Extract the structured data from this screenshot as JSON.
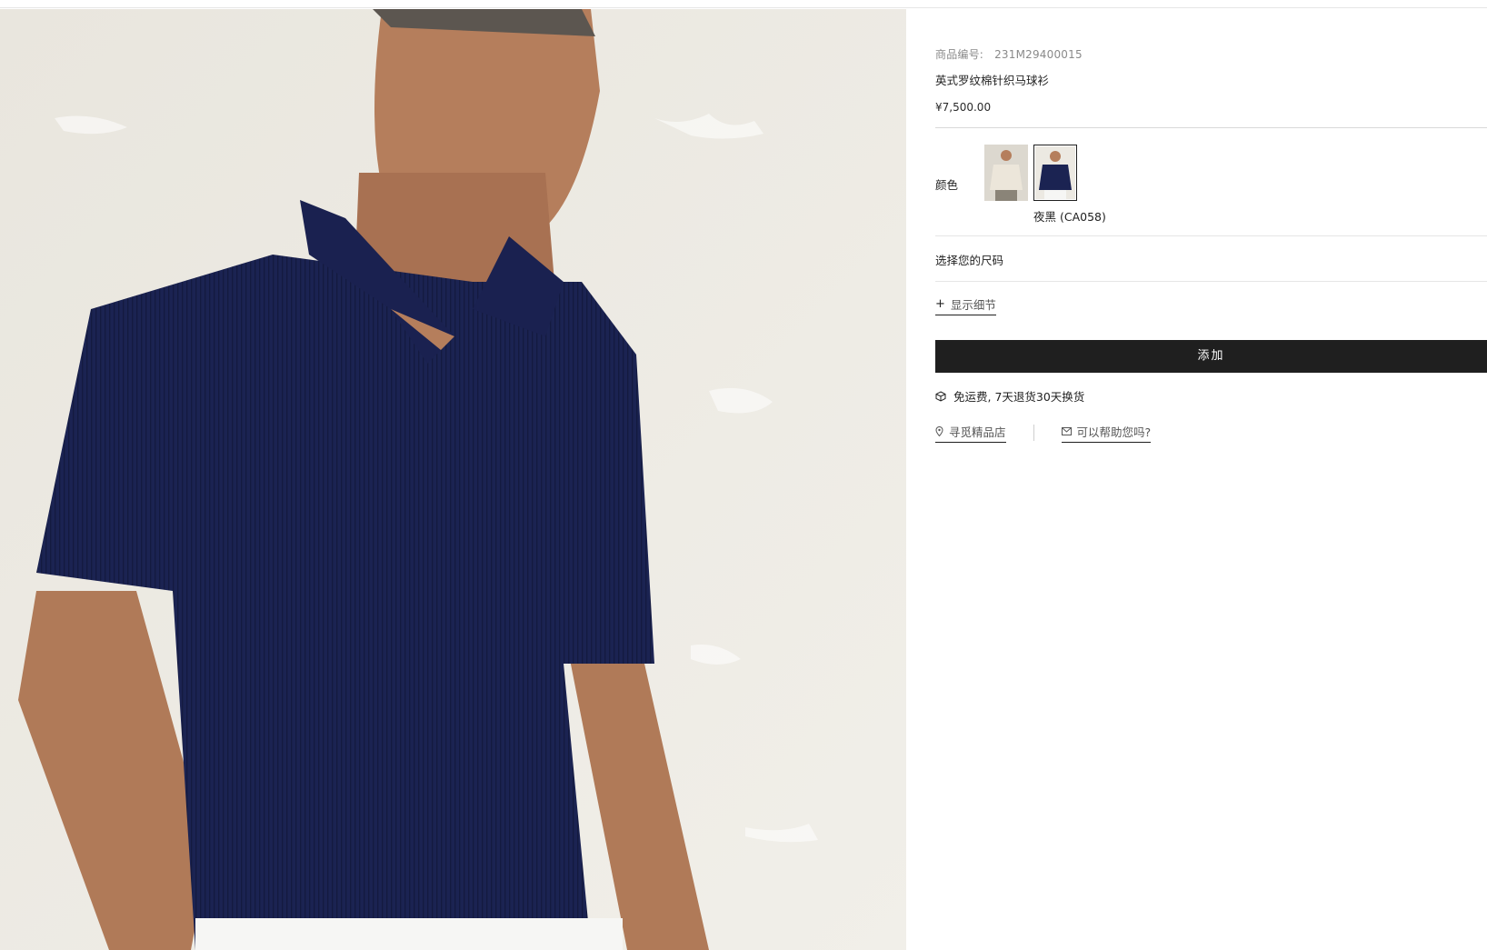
{
  "product": {
    "sku_label": "商品编号:",
    "sku_value": "231M29400015",
    "title": "英式罗纹棉针织马球衫",
    "price": "¥7,500.00"
  },
  "color": {
    "label": "颜色",
    "selected_caption": "夜黑 (CA058)",
    "swatches": [
      {
        "name": "beige",
        "tone": "#e8e2d6"
      },
      {
        "name": "navy",
        "tone": "#1b2352"
      }
    ]
  },
  "size": {
    "select_label": "选择您的尺码"
  },
  "details": {
    "toggle_label": "显示细节"
  },
  "cart": {
    "add_label": "添加"
  },
  "shipping": {
    "text": "免运费, 7天退货30天换货"
  },
  "links": {
    "store_locator": "寻觅精品店",
    "help": "可以帮助您吗?"
  },
  "colors": {
    "button_bg": "#1f1f1f",
    "shirt": "#1b2352",
    "wall": "#ece9e2"
  }
}
